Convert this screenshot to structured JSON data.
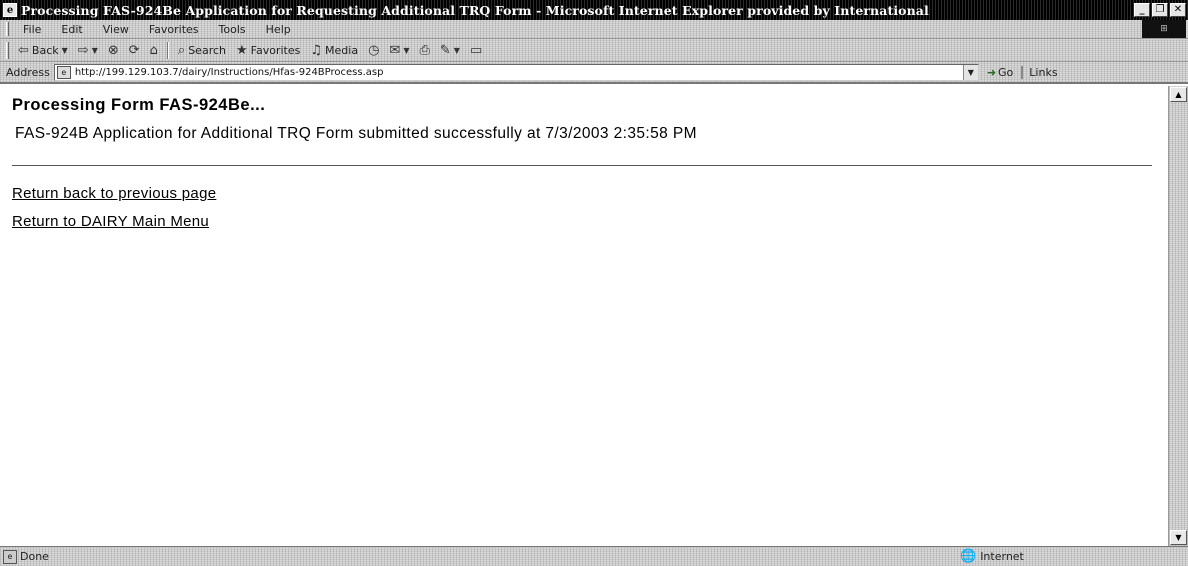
{
  "window": {
    "title": "Processing FAS-924Be Application for Requesting Additional TRQ Form - Microsoft Internet Explorer provided by International",
    "controls": [
      "_",
      "❐",
      "✕"
    ]
  },
  "menu": {
    "items": [
      "File",
      "Edit",
      "View",
      "Favorites",
      "Tools",
      "Help"
    ]
  },
  "toolbar": {
    "back_label": "Back",
    "search_label": "Search",
    "favorites_label": "Favorites",
    "media_label": "Media"
  },
  "address": {
    "label": "Address",
    "url": "http://199.129.103.7/dairy/Instructions/Hfas-924BProcess.asp",
    "go_label": "Go",
    "links_label": "Links"
  },
  "page": {
    "heading": "Processing Form FAS-924Be...",
    "message": "FAS-924B Application for Additional TRQ Form submitted successfully at 7/3/2003 2:35:58 PM",
    "links": [
      "Return back to previous page",
      "Return to DAIRY Main Menu"
    ]
  },
  "status": {
    "text": "Done",
    "zone": "Internet"
  }
}
